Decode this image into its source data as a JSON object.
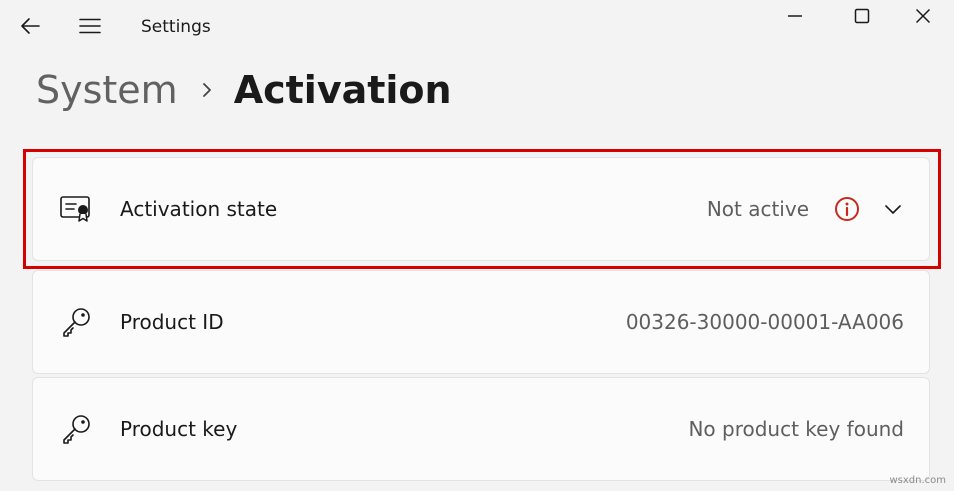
{
  "window": {
    "title": "Settings",
    "controls": [
      "minimize-icon",
      "maximize-icon",
      "close-icon"
    ]
  },
  "nav": {
    "back_icon": "back-arrow-icon",
    "menu_icon": "hamburger-menu-icon"
  },
  "breadcrumb": {
    "parent": "System",
    "separator_icon": "chevron-right-icon",
    "current": "Activation"
  },
  "cards": [
    {
      "label": "Activation state",
      "value": "Not active",
      "icon": "certificate-icon",
      "status_icon": "info-icon",
      "expand_icon": "chevron-down-icon",
      "highlighted": true
    },
    {
      "label": "Product ID",
      "value": "00326-30000-00001-AA006",
      "icon": "key-icon"
    },
    {
      "label": "Product key",
      "value": "No product key found",
      "icon": "key-icon"
    }
  ],
  "colors": {
    "highlight": "#d60000",
    "warning": "#c42b1c",
    "background": "#f3f3f3",
    "card": "#fbfbfb"
  },
  "watermark": "wsxdn.com"
}
